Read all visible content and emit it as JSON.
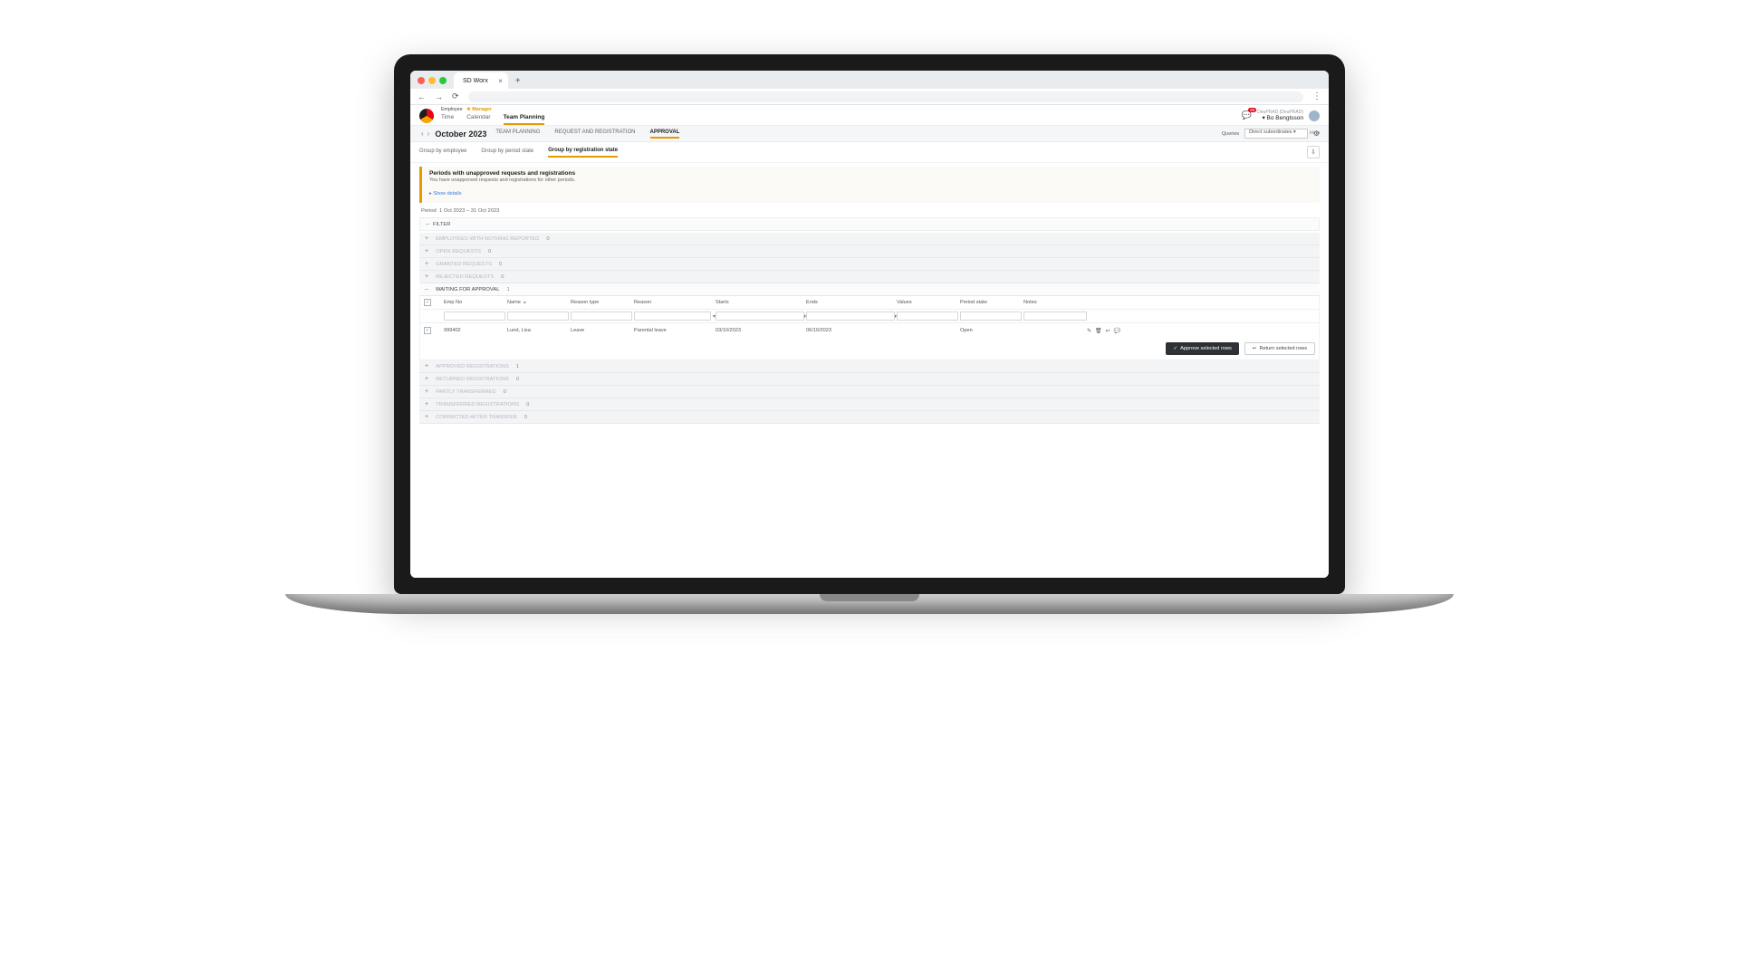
{
  "browser": {
    "tab_title": "SD Worx"
  },
  "header": {
    "roles": {
      "employee": "Employee",
      "manager": "Manager"
    },
    "nav": [
      "Time",
      "Calendar",
      "Team Planning"
    ],
    "nav_active": 2,
    "org": "DeuPRAD (DeuPRAD)",
    "user": "Bo Bengtsson",
    "notif_count": "99",
    "help": "Help"
  },
  "period_bar": {
    "month": "October 2023",
    "tabs": [
      "TEAM PLANNING",
      "REQUEST AND REGISTRATION",
      "APPROVAL"
    ],
    "active": 2,
    "queries_label": "Queries",
    "queries_value": "Direct subordinates"
  },
  "group_bar": {
    "options": [
      "Group by employee",
      "Group by period state",
      "Group by registration state"
    ],
    "active": 2
  },
  "alert": {
    "title": "Periods with unapproved requests and registrations",
    "sub": "You have unapproved requests and registrations for other periods.",
    "link": "Show details"
  },
  "period_text_label": "Period",
  "period_text_value": "1 Oct 2023 – 31 Oct 2023",
  "filter_label": "FILTER",
  "sections_top": [
    {
      "label": "EMPLOYEES WITH NOTHING REPORTED",
      "count": "0"
    },
    {
      "label": "OPEN REQUESTS",
      "count": "0"
    },
    {
      "label": "GRANTED REQUESTS",
      "count": "0"
    },
    {
      "label": "REJECTED REQUESTS",
      "count": "0"
    }
  ],
  "section_waiting": {
    "label": "WAITING FOR APPROVAL",
    "count": "1"
  },
  "sections_bottom": [
    {
      "label": "APPROVED REGISTRATIONS",
      "count": "1"
    },
    {
      "label": "RETURNED REGISTRATIONS",
      "count": "0"
    },
    {
      "label": "PARTLY TRANSFERRED",
      "count": "0"
    },
    {
      "label": "TRANSFERRED REGISTRATIONS",
      "count": "0"
    },
    {
      "label": "CORRECTED AFTER TRANSFER",
      "count": "0"
    }
  ],
  "table": {
    "headers": [
      "Emp No",
      "Name",
      "Reason type",
      "Reason",
      "Starts",
      "Ends",
      "Values",
      "Period state",
      "Notes"
    ],
    "row": {
      "emp_no": "999402",
      "name": "Lund, Lisa",
      "reason_type": "Leave",
      "reason": "Parental leave",
      "starts": "03/10/2023",
      "ends": "06/10/2023",
      "values": "",
      "period_state": "Open",
      "notes": ""
    },
    "approve_btn": "Approve selected rows",
    "return_btn": "Return selected rows"
  }
}
